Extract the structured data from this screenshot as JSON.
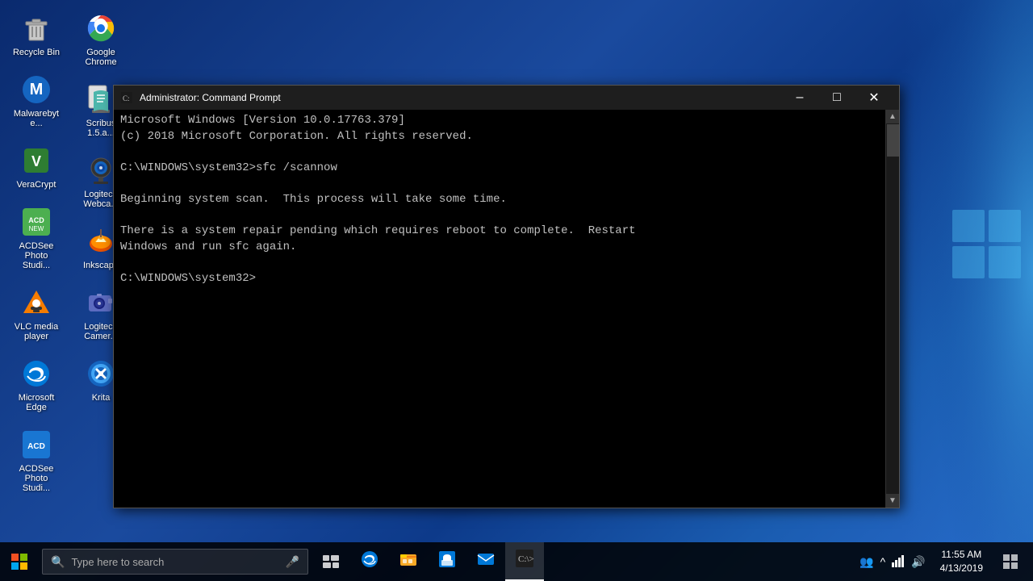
{
  "desktop": {
    "icons": [
      {
        "id": "recycle-bin",
        "label": "Recycle Bin",
        "type": "recycle"
      },
      {
        "id": "malwarebytes",
        "label": "Malwarebyte...",
        "type": "malwarebytes"
      },
      {
        "id": "veracrypt",
        "label": "VeraCrypt",
        "type": "veracrypt"
      },
      {
        "id": "acdsee-photo-studio-top",
        "label": "ACDSee Photo Studi...",
        "type": "acdsee"
      },
      {
        "id": "vlc",
        "label": "VLC media player",
        "type": "vlc"
      },
      {
        "id": "microsoft-edge",
        "label": "Microsoft Edge",
        "type": "edge"
      },
      {
        "id": "acdsee-photo-studio-bot",
        "label": "ACDSee Photo Studi...",
        "type": "acdsee2"
      },
      {
        "id": "google-chrome",
        "label": "Google Chrome",
        "type": "chrome"
      },
      {
        "id": "scribus",
        "label": "Scribus 1.5.a...",
        "type": "scribus"
      },
      {
        "id": "logitech-webcam",
        "label": "Logitech Webca...",
        "type": "webcam"
      },
      {
        "id": "inkscape",
        "label": "Inkscape",
        "type": "inkscape"
      },
      {
        "id": "logitech-camera",
        "label": "Logitech Camer...",
        "type": "camera"
      },
      {
        "id": "krita",
        "label": "Krita",
        "type": "krita"
      }
    ]
  },
  "cmd_window": {
    "title": "Administrator: Command Prompt",
    "content": "Microsoft Windows [Version 10.0.17763.379]\n(c) 2018 Microsoft Corporation. All rights reserved.\n\nC:\\WINDOWS\\system32>sfc /scannow\n\nBeginning system scan.  This process will take some time.\n\nThere is a system repair pending which requires reboot to complete.  Restart\nWindows and run sfc again.\n\nC:\\WINDOWS\\system32>"
  },
  "taskbar": {
    "search_placeholder": "Type here to search",
    "apps": [
      {
        "id": "edge",
        "label": "Microsoft Edge",
        "active": false
      },
      {
        "id": "explorer",
        "label": "File Explorer",
        "active": false
      },
      {
        "id": "store",
        "label": "Microsoft Store",
        "active": false
      },
      {
        "id": "mail",
        "label": "Mail",
        "active": false
      },
      {
        "id": "cmd",
        "label": "Command Prompt",
        "active": true
      }
    ],
    "clock": {
      "time": "11:55 AM",
      "date": "4/13/2019"
    }
  }
}
